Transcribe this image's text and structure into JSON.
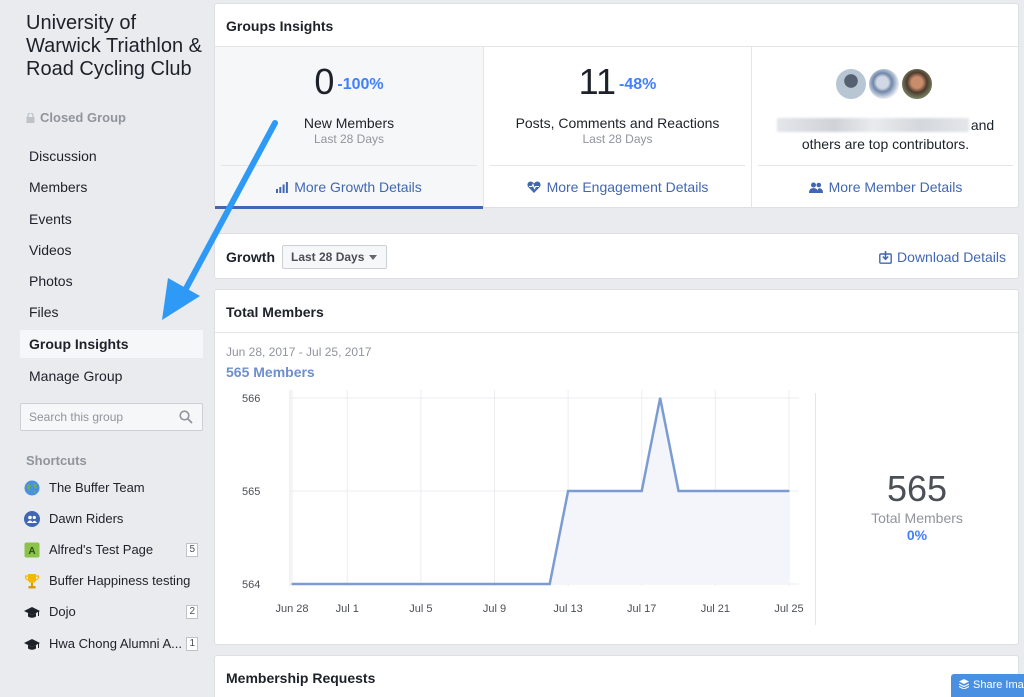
{
  "sidebar": {
    "group_name": "University of Warwick Triathlon & Road Cycling Club",
    "privacy": "Closed Group",
    "nav": [
      {
        "label": "Discussion"
      },
      {
        "label": "Members"
      },
      {
        "label": "Events"
      },
      {
        "label": "Videos"
      },
      {
        "label": "Photos"
      },
      {
        "label": "Files"
      },
      {
        "label": "Group Insights",
        "active": true
      },
      {
        "label": "Manage Group"
      }
    ],
    "search_placeholder": "Search this group",
    "shortcuts_title": "Shortcuts",
    "shortcuts": [
      {
        "label": "The Buffer Team",
        "icon": "globe-icon"
      },
      {
        "label": "Dawn Riders",
        "icon": "group-icon"
      },
      {
        "label": "Alfred's Test Page",
        "icon": "page-icon",
        "badge": "5"
      },
      {
        "label": "Buffer Happiness testing",
        "icon": "trophy-icon"
      },
      {
        "label": "Dojo",
        "icon": "graduation-cap-icon",
        "badge": "2"
      },
      {
        "label": "Hwa Chong Alumni A...",
        "icon": "graduation-cap-icon",
        "badge": "1"
      }
    ]
  },
  "insights": {
    "title": "Groups Insights",
    "new_members": {
      "value": "0",
      "change": "-100%",
      "label": "New Members",
      "period": "Last 28 Days",
      "link": "More Growth Details"
    },
    "engagement": {
      "value": "11",
      "change": "-48%",
      "label": "Posts, Comments and Reactions",
      "period": "Last 28 Days",
      "link": "More Engagement Details"
    },
    "contributors": {
      "text": "and others are top contributors.",
      "link": "More Member Details"
    }
  },
  "growth": {
    "title": "Growth",
    "range": "Last 28 Days",
    "download": "Download Details"
  },
  "total_members": {
    "title": "Total Members",
    "date_range": "Jun 28, 2017 - Jul 25, 2017",
    "count_label": "565  Members",
    "stat_value": "565",
    "stat_label": "Total Members",
    "stat_change": "0%"
  },
  "requests": {
    "title": "Membership Requests"
  },
  "share_button": "Share Imag",
  "colors": {
    "accent": "#4267b2",
    "positive": "#4080ff",
    "line": "#7b9cd3",
    "arrow": "#2e9af5"
  },
  "chart_data": {
    "type": "area",
    "title": "",
    "x": [
      "Jun 28",
      "Jun 29",
      "Jun 30",
      "Jul 1",
      "Jul 2",
      "Jul 3",
      "Jul 4",
      "Jul 5",
      "Jul 6",
      "Jul 7",
      "Jul 8",
      "Jul 9",
      "Jul 10",
      "Jul 11",
      "Jul 12",
      "Jul 13",
      "Jul 14",
      "Jul 15",
      "Jul 16",
      "Jul 17",
      "Jul 18",
      "Jul 19",
      "Jul 20",
      "Jul 21",
      "Jul 22",
      "Jul 23",
      "Jul 24",
      "Jul 25"
    ],
    "xticks": [
      "Jun 28",
      "Jul 1",
      "Jul 5",
      "Jul 9",
      "Jul 13",
      "Jul 17",
      "Jul 21",
      "Jul 25"
    ],
    "series": [
      {
        "values": [
          564,
          564,
          564,
          564,
          564,
          564,
          564,
          564,
          564,
          564,
          564,
          564,
          564,
          564,
          564,
          565,
          565,
          565,
          565,
          565,
          566,
          565,
          565,
          565,
          565,
          565,
          565,
          565
        ]
      }
    ],
    "yticks": [
      564,
      565,
      566
    ],
    "ylim": [
      564,
      566
    ],
    "grid": true
  }
}
